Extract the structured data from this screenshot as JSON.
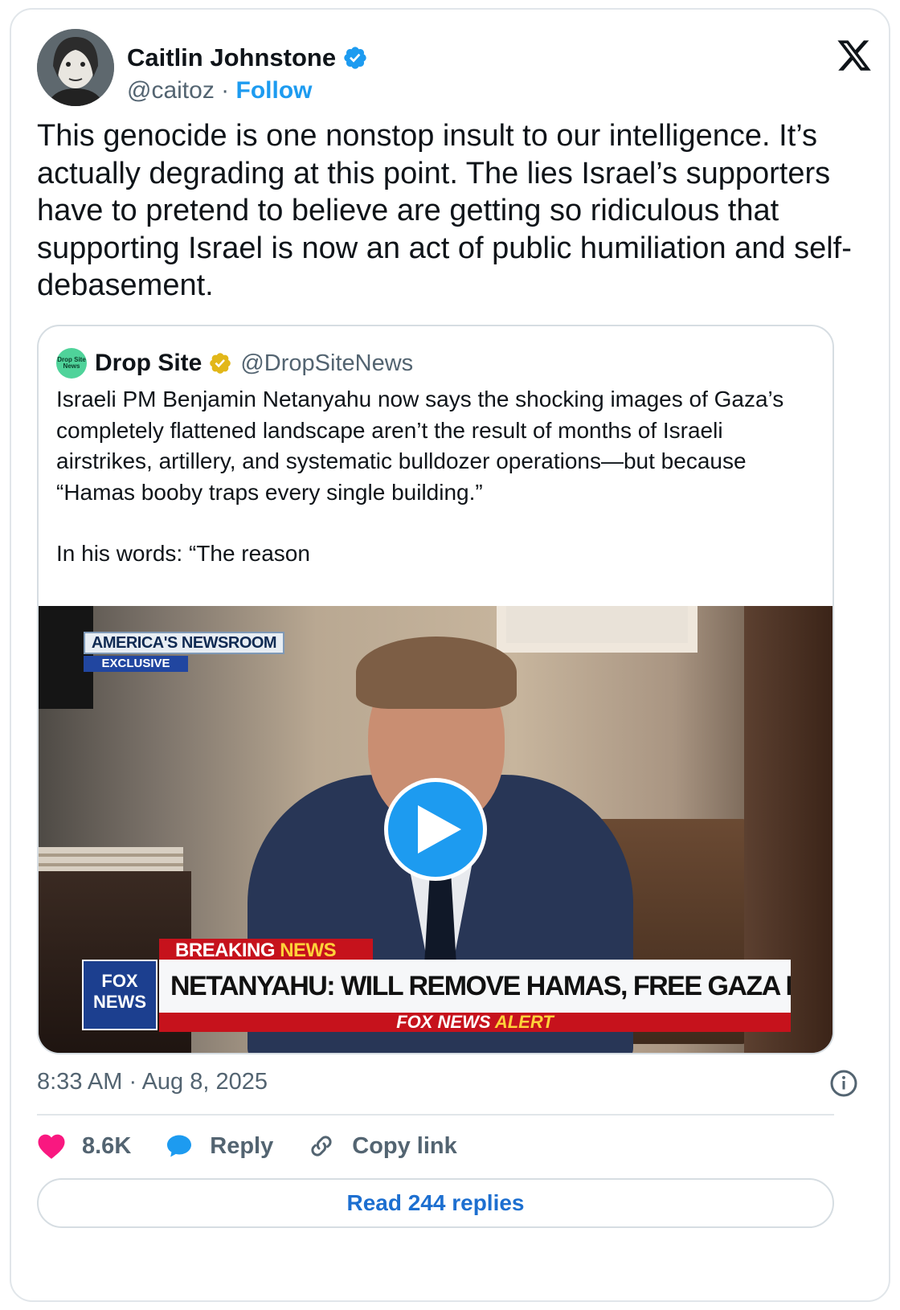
{
  "author": {
    "name": "Caitlin Johnstone",
    "handle": "@caitoz",
    "separator": "·",
    "follow_label": "Follow"
  },
  "tweet_text": "This genocide is one nonstop insult to our intelligence. It’s actually degrading at this point. The lies Israel’s supporters have to pretend to believe are getting so ridiculous that supporting Israel is now an act of public humiliation and self-debasement.",
  "quoted": {
    "avatar_text": "Drop Site News",
    "name": "Drop Site",
    "handle": "@DropSiteNews",
    "paragraph_1": "Israeli PM Benjamin Netanyahu now says the shocking images of Gaza’s completely flattened landscape aren’t the result of months of Israeli airstrikes, artillery, and systematic bulldozer operations—but because “Hamas booby traps every single building.”",
    "paragraph_2": "In his words: “The reason",
    "video": {
      "show_name": "AMERICA'S NEWSROOM",
      "show_tag": "EXCLUSIVE",
      "breaking_1": "BREAKING",
      "breaking_2": "NEWS",
      "logo_line_1": "FOX",
      "logo_line_2": "NEWS",
      "headline": "NETANYAHU: WILL REMOVE HAMAS, FREE GAZA POPULATION",
      "alert_1": "FOX NEWS",
      "alert_2": "ALERT"
    }
  },
  "timestamp": "8:33 AM · Aug 8, 2025",
  "actions": {
    "likes": "8.6K",
    "reply_label": "Reply",
    "copy_label": "Copy link"
  },
  "read_replies_label": "Read 244 replies",
  "colors": {
    "accent": "#1d9bf0",
    "like": "#f91880",
    "text": "#0f1419",
    "muted": "#536471"
  }
}
